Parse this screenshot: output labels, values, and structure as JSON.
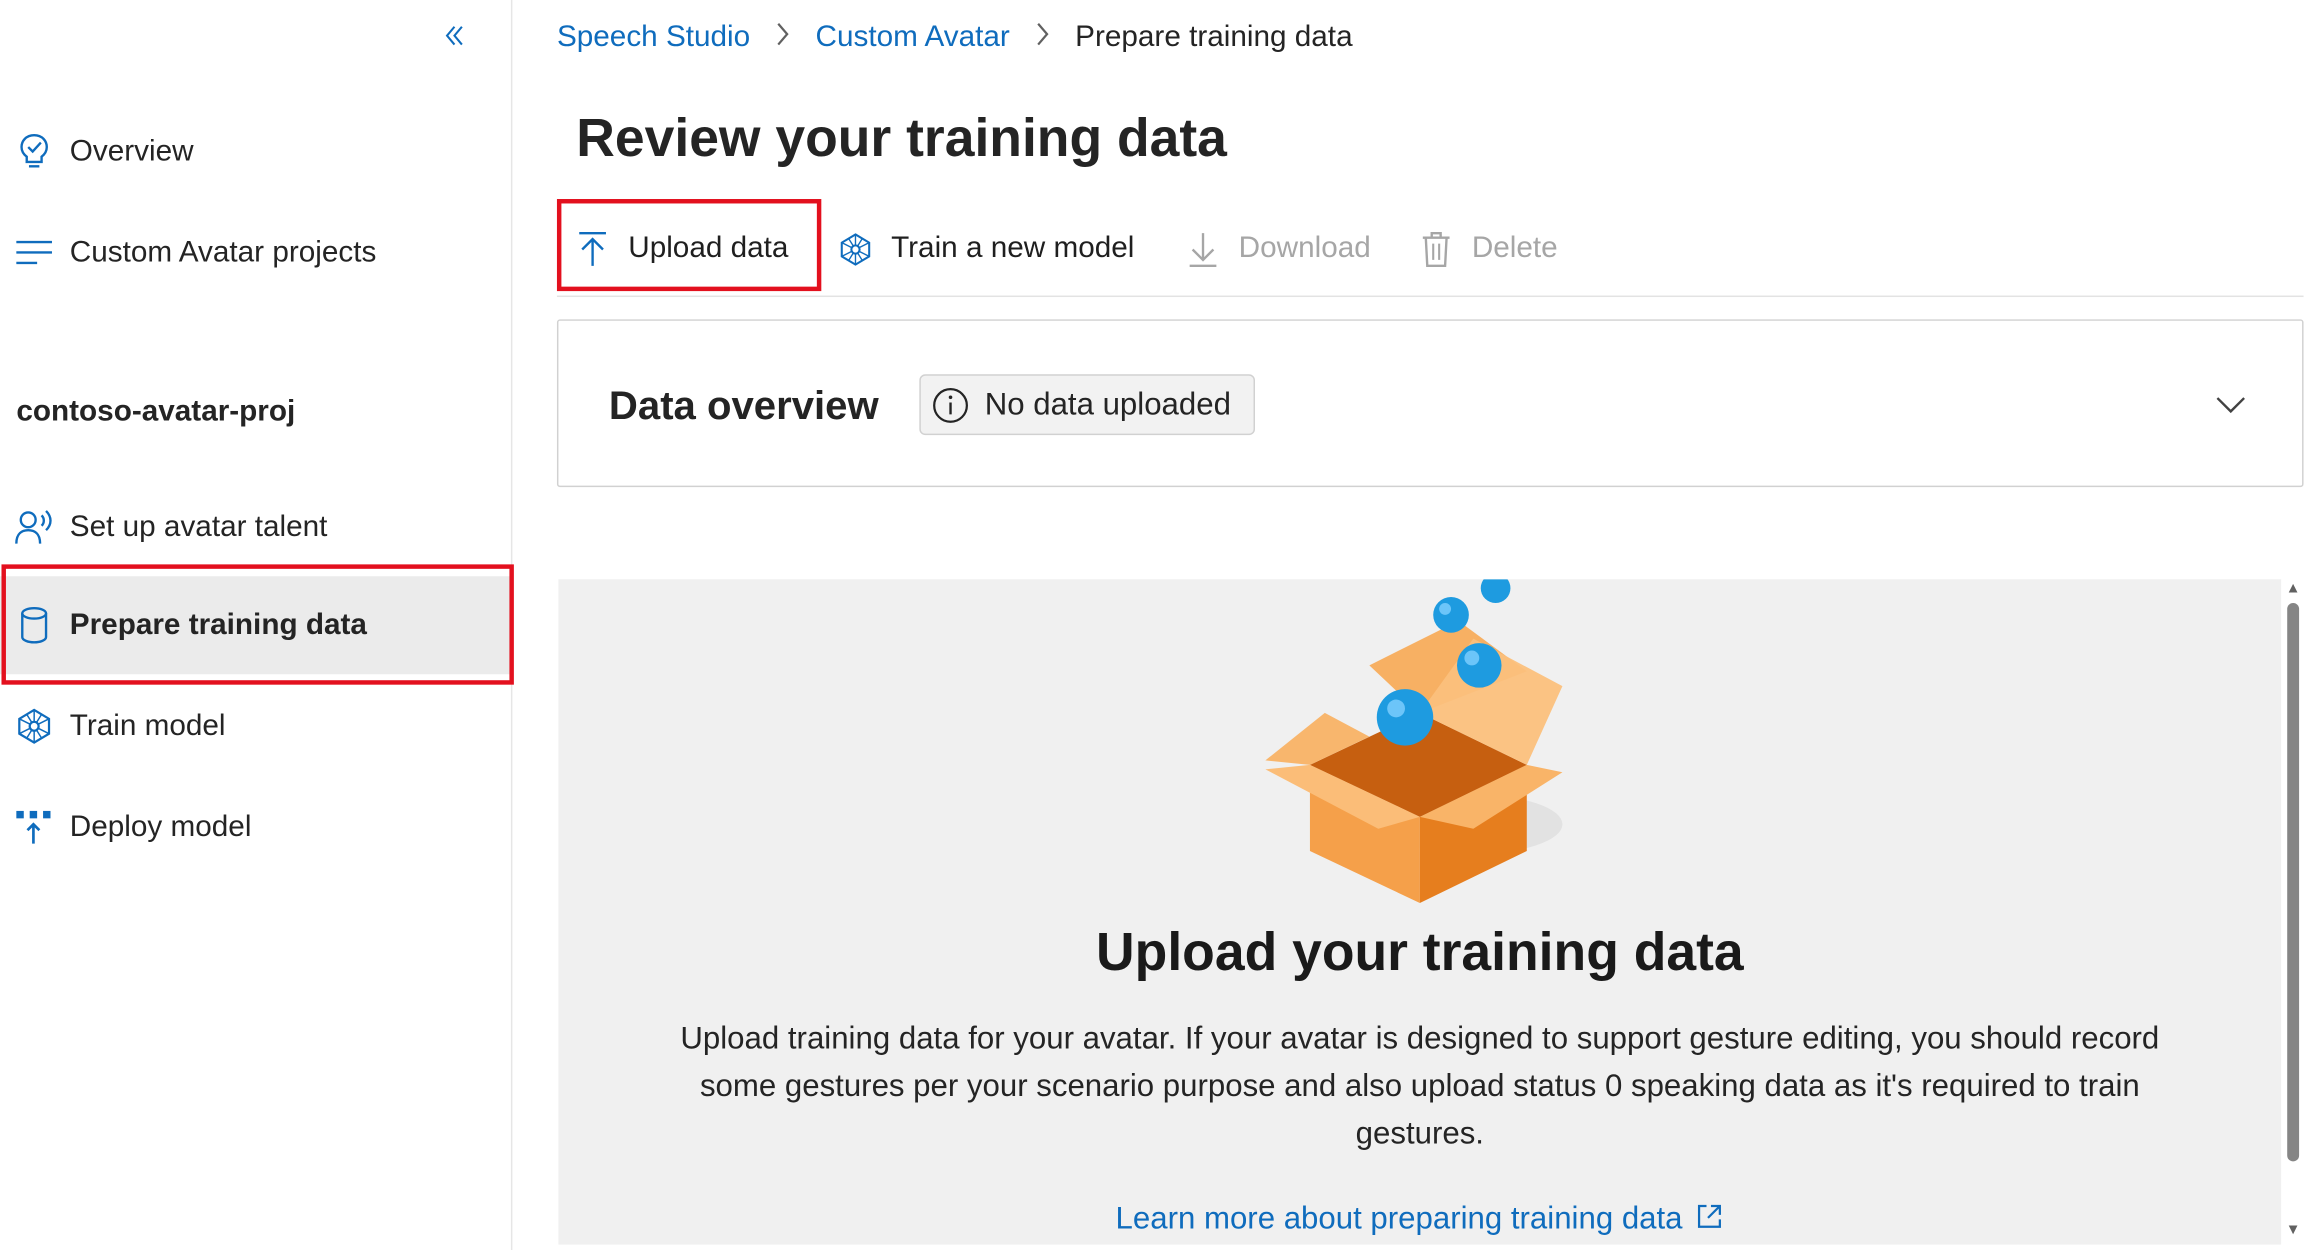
{
  "sidebar": {
    "collapse_glyph": "«",
    "top_items": [
      {
        "label": "Overview",
        "icon": "lightbulb-check-icon"
      },
      {
        "label": "Custom Avatar projects",
        "icon": "text-lines-icon"
      }
    ],
    "project_name": "contoso-avatar-proj",
    "project_items": [
      {
        "label": "Set up avatar talent",
        "icon": "person-voice-icon"
      },
      {
        "label": "Prepare training data",
        "icon": "database-icon",
        "active": true
      },
      {
        "label": "Train model",
        "icon": "brain-network-icon"
      },
      {
        "label": "Deploy model",
        "icon": "deploy-icon"
      }
    ]
  },
  "breadcrumb": {
    "items": [
      "Speech Studio",
      "Custom Avatar"
    ],
    "current": "Prepare training data",
    "separator": ">"
  },
  "page": {
    "title": "Review your training data"
  },
  "toolbar": {
    "upload_label": "Upload data",
    "train_label": "Train a new model",
    "download_label": "Download",
    "delete_label": "Delete"
  },
  "data_overview": {
    "title": "Data overview",
    "status": "No data uploaded"
  },
  "empty_state": {
    "title": "Upload your training data",
    "description": "Upload training data for your avatar. If your avatar is designed to support gesture editing, you should record some gestures per your scenario purpose and also upload status 0 speaking data as it's required to train gestures.",
    "link": "Learn more about preparing training data"
  },
  "colors": {
    "accent": "#0f6cbd",
    "highlight_border": "#e3101e",
    "box_orange": "#f28c28",
    "ball_blue": "#1e9be0"
  }
}
